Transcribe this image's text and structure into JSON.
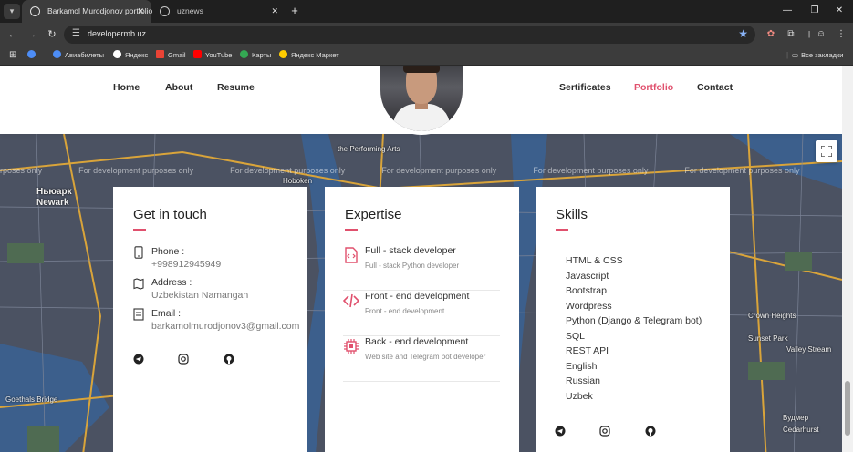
{
  "browser": {
    "tabs": [
      {
        "title": "Barkamol Murodjonov portfolio",
        "active": true
      },
      {
        "title": "uznews",
        "active": false
      }
    ],
    "url": "developermb.uz",
    "bookmarks": [
      {
        "label": "Авиабилеты",
        "color": "#4d8df6"
      },
      {
        "label": "Яндекс",
        "color": "#ffffff"
      },
      {
        "label": "Gmail",
        "color": "#ea4335"
      },
      {
        "label": "YouTube",
        "color": "#ff0000"
      },
      {
        "label": "Карты",
        "color": "#34a853"
      },
      {
        "label": "Яндекс Маркет",
        "color": "#ffcc00"
      }
    ],
    "all_bookmarks": "Все закладки"
  },
  "nav": {
    "home": "Home",
    "about": "About",
    "resume": "Resume",
    "sertificates": "Sertificates",
    "portfolio": "Portfolio",
    "contact": "Contact"
  },
  "map": {
    "watermark": "For development purposes only",
    "labels": [
      "Ньюарк",
      "Newark",
      "Hoboken",
      "the Performing Arts",
      "Goethals Bridge",
      "Sunset Park",
      "Crown Heights",
      "Valley Stream",
      "Вудмер",
      "Cedarhurst"
    ]
  },
  "contact_card": {
    "title": "Get in touch",
    "phone_label": "Phone :",
    "phone": "+998912945949",
    "address_label": "Address :",
    "address": "Uzbekistan Namangan",
    "email_label": "Email :",
    "email": "barkamolmurodjonov3@gmail.com"
  },
  "expertise_card": {
    "title": "Expertise",
    "items": [
      {
        "title": "Full - stack developer",
        "subtitle": "Full - stack Python developer"
      },
      {
        "title": "Front - end development",
        "subtitle": "Front - end development"
      },
      {
        "title": "Back - end development",
        "subtitle": "Web site and Telegram bot developer"
      }
    ]
  },
  "skills_card": {
    "title": "Skills",
    "items": [
      "HTML & CSS",
      "Javascript",
      "Bootstrap",
      "Wordpress",
      "Python (Django & Telegram bot)",
      "SQL",
      "REST API",
      "English",
      "Russian",
      "Uzbek"
    ]
  },
  "colors": {
    "accent": "#e0506d"
  }
}
